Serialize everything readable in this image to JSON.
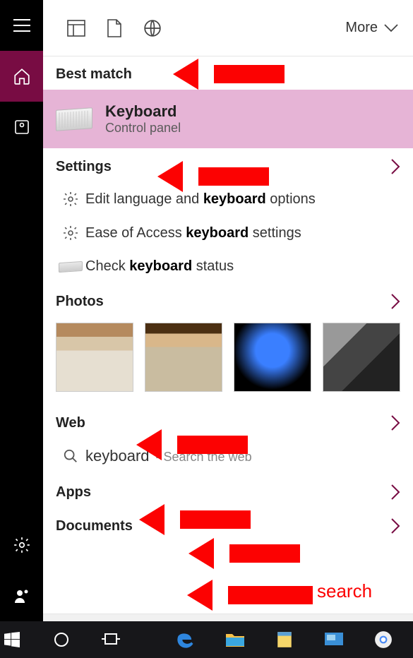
{
  "topBar": {
    "moreLabel": "More"
  },
  "sections": {
    "bestMatch": {
      "header": "Best match"
    },
    "settings": {
      "header": "Settings",
      "items": [
        {
          "pre": "Edit language and ",
          "bold": "keyboard",
          "post": " options"
        },
        {
          "pre": "Ease of Access ",
          "bold": "keyboard",
          "post": " settings"
        },
        {
          "pre": "Check ",
          "bold": "keyboard",
          "post": " status"
        }
      ]
    },
    "photos": {
      "header": "Photos"
    },
    "web": {
      "header": "Web",
      "items": [
        {
          "term": "keyboard",
          "hint": " - Search the web"
        }
      ]
    },
    "apps": {
      "header": "Apps"
    },
    "documents": {
      "header": "Documents"
    }
  },
  "bestMatch": {
    "title": "Keyboard",
    "subtitle": "Control panel"
  },
  "search": {
    "value": "keyboard"
  },
  "annotation": {
    "label": "search"
  }
}
